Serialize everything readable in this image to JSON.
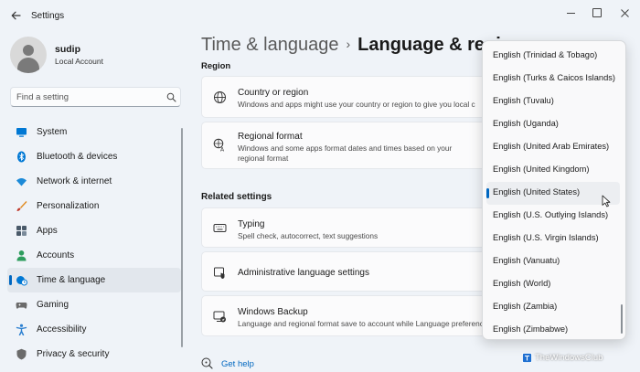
{
  "window": {
    "title": "Settings"
  },
  "profile": {
    "name": "sudip",
    "account_type": "Local Account"
  },
  "search": {
    "placeholder": "Find a setting"
  },
  "nav": {
    "items": [
      {
        "label": "System",
        "icon": "monitor-icon",
        "color": "#0078d4"
      },
      {
        "label": "Bluetooth & devices",
        "icon": "bluetooth-icon",
        "color": "#0078d4"
      },
      {
        "label": "Network & internet",
        "icon": "wifi-icon",
        "color": "#1c8ad8"
      },
      {
        "label": "Personalization",
        "icon": "brush-icon",
        "color": "#e08a1e"
      },
      {
        "label": "Apps",
        "icon": "apps-icon",
        "color": "#4a5a6a"
      },
      {
        "label": "Accounts",
        "icon": "accounts-icon",
        "color": "#2e9d5e"
      },
      {
        "label": "Time & language",
        "icon": "globe-clock-icon",
        "color": "#0078d4"
      },
      {
        "label": "Gaming",
        "icon": "gamepad-icon",
        "color": "#6b6b6b"
      },
      {
        "label": "Accessibility",
        "icon": "accessibility-icon",
        "color": "#2a7fd0"
      },
      {
        "label": "Privacy & security",
        "icon": "shield-icon",
        "color": "#6b6b6b"
      }
    ],
    "active_index": 6
  },
  "header": {
    "parent": "Time & language",
    "separator": "›",
    "current": "Language & regi"
  },
  "sections": {
    "region": "Region",
    "related": "Related settings"
  },
  "cards": {
    "country": {
      "title": "Country or region",
      "desc": "Windows and apps might use your country or region to give you local c"
    },
    "format": {
      "title": "Regional format",
      "desc": "Windows and some apps format dates and times based on your regional format"
    },
    "typing": {
      "title": "Typing",
      "desc": "Spell check, autocorrect, text suggestions"
    },
    "admin": {
      "title": "Administrative language settings"
    },
    "backup": {
      "title": "Windows Backup",
      "desc": "Language and regional format save to account while Language preferenc"
    }
  },
  "help": {
    "label": "Get help"
  },
  "dropdown": {
    "options": [
      "English (Trinidad & Tobago)",
      "English (Turks & Caicos Islands)",
      "English (Tuvalu)",
      "English (Uganda)",
      "English (United Arab Emirates)",
      "English (United Kingdom)",
      "English (United States)",
      "English (U.S. Outlying Islands)",
      "English (U.S. Virgin Islands)",
      "English (Vanuatu)",
      "English (World)",
      "English (Zambia)",
      "English (Zimbabwe)"
    ],
    "selected_index": 6
  },
  "watermark": {
    "text": "TheWindowsClub"
  },
  "colors": {
    "accent": "#0067c0",
    "background": "#eff3f8",
    "card": "#fbfbfc"
  }
}
